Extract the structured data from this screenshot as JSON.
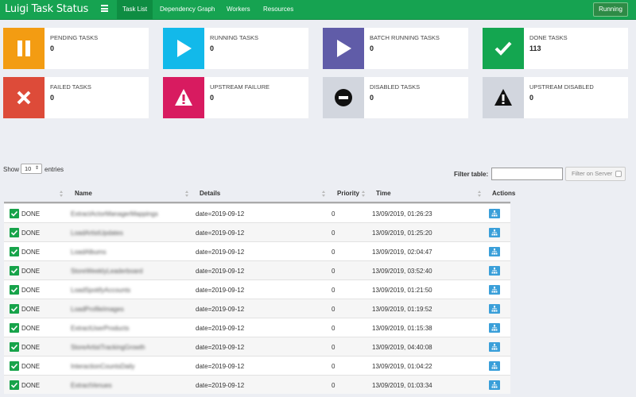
{
  "navbar": {
    "brand": "Luigi Task Status",
    "tabs": [
      {
        "label": "Task List",
        "active": true
      },
      {
        "label": "Dependency Graph",
        "active": false
      },
      {
        "label": "Workers",
        "active": false
      },
      {
        "label": "Resources",
        "active": false
      }
    ],
    "status_button": "Running"
  },
  "tiles": [
    {
      "title": "PENDING TASKS",
      "value": "0",
      "color": "#f39c12",
      "icon": "pause-icon"
    },
    {
      "title": "RUNNING TASKS",
      "value": "0",
      "color": "#12b9ea",
      "icon": "play-icon"
    },
    {
      "title": "BATCH RUNNING TASKS",
      "value": "0",
      "color": "#605ca8",
      "icon": "play-icon"
    },
    {
      "title": "DONE TASKS",
      "value": "113",
      "color": "#14a650",
      "icon": "check-icon"
    },
    {
      "title": "FAILED TASKS",
      "value": "0",
      "color": "#dd4b39",
      "icon": "x-icon"
    },
    {
      "title": "UPSTREAM FAILURE",
      "value": "0",
      "color": "#d81b60",
      "icon": "warning-icon"
    },
    {
      "title": "DISABLED TASKS",
      "value": "0",
      "color": "#d2d6de",
      "icon": "minus-circle-icon"
    },
    {
      "title": "UPSTREAM DISABLED",
      "value": "0",
      "color": "#d2d6de",
      "icon": "warning-icon"
    }
  ],
  "table_controls": {
    "show_label": "Show",
    "page_size": "10",
    "entries_label": "entries",
    "filter_label": "Filter table:",
    "filter_value": "",
    "filter_server_label": "Filter on Server"
  },
  "table": {
    "columns": [
      "Name",
      "Details",
      "Priority",
      "Time",
      "Actions"
    ],
    "rows": [
      {
        "status": "DONE",
        "name": "ExtractActorManagerMappings",
        "details": "date=2019-09-12",
        "priority": "0",
        "time": "13/09/2019, 01:26:23"
      },
      {
        "status": "DONE",
        "name": "LoadArtistUpdates",
        "details": "date=2019-09-12",
        "priority": "0",
        "time": "13/09/2019, 01:25:20"
      },
      {
        "status": "DONE",
        "name": "LoadAlbums",
        "details": "date=2019-09-12",
        "priority": "0",
        "time": "13/09/2019, 02:04:47"
      },
      {
        "status": "DONE",
        "name": "StoreWeeklyLeaderboard",
        "details": "date=2019-09-12",
        "priority": "0",
        "time": "13/09/2019, 03:52:40"
      },
      {
        "status": "DONE",
        "name": "LoadSpotifyAccounts",
        "details": "date=2019-09-12",
        "priority": "0",
        "time": "13/09/2019, 01:21:50"
      },
      {
        "status": "DONE",
        "name": "LoadProfileImages",
        "details": "date=2019-09-12",
        "priority": "0",
        "time": "13/09/2019, 01:19:52"
      },
      {
        "status": "DONE",
        "name": "ExtractUserProducts",
        "details": "date=2019-09-12",
        "priority": "0",
        "time": "13/09/2019, 01:15:38"
      },
      {
        "status": "DONE",
        "name": "StoreArtistTrackingGrowth",
        "details": "date=2019-09-12",
        "priority": "0",
        "time": "13/09/2019, 04:40:08"
      },
      {
        "status": "DONE",
        "name": "InteractionCountsDaily",
        "details": "date=2019-09-12",
        "priority": "0",
        "time": "13/09/2019, 01:04:22"
      },
      {
        "status": "DONE",
        "name": "ExtractVenues",
        "details": "date=2019-09-12",
        "priority": "0",
        "time": "13/09/2019, 01:03:34"
      }
    ]
  }
}
